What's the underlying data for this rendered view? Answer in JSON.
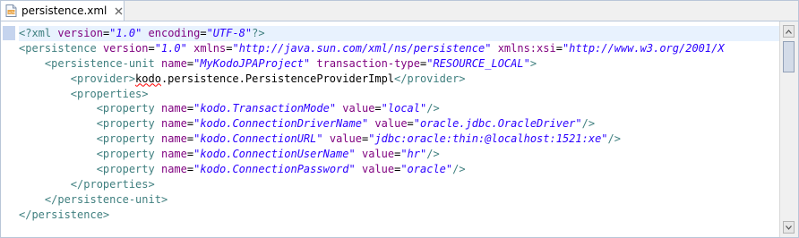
{
  "tab": {
    "label": "persistence.xml",
    "icon": "xml-file-icon",
    "close_icon": "close-icon"
  },
  "colors": {
    "tag": "#3f7f7f",
    "attribute": "#7f007f",
    "value": "#2a00ff",
    "text": "#000000",
    "current_line": "#e8f2fe"
  },
  "code": {
    "l1": {
      "open": "<?xml",
      "a1": "version",
      "eq1": "=",
      "v1": "\"1.0\"",
      "a2": "encoding",
      "eq2": "=",
      "v2": "\"UTF-8\"",
      "close": "?>"
    },
    "l2": {
      "open": "<persistence",
      "a1": "version",
      "eq1": "=",
      "v1": "\"1.0\"",
      "a2": "xmlns",
      "eq2": "=",
      "v2": "\"http://java.sun.com/xml/ns/persistence\"",
      "a3": "xmlns:xsi",
      "eq3": "=",
      "v3": "\"http://www.w3.org/2001/X"
    },
    "l3": {
      "open": "<persistence-unit",
      "a1": "name",
      "eq1": "=",
      "v1": "\"MyKodoJPAProject\"",
      "a2": "transaction-type",
      "eq2": "=",
      "v2": "\"RESOURCE_LOCAL\"",
      "close": ">"
    },
    "l4": {
      "open": "<provider>",
      "text_underlined": "kodo",
      "text_rest": ".persistence.PersistenceProviderImpl",
      "close": "</provider>"
    },
    "l5": {
      "open": "<properties>"
    },
    "props": [
      {
        "open": "<property",
        "a1": "name",
        "eq1": "=",
        "v1": "\"kodo.TransactionMode\"",
        "a2": "value",
        "eq2": "=",
        "v2": "\"local\"",
        "close": "/>"
      },
      {
        "open": "<property",
        "a1": "name",
        "eq1": "=",
        "v1": "\"kodo.ConnectionDriverName\"",
        "a2": "value",
        "eq2": "=",
        "v2": "\"oracle.jdbc.OracleDriver\"",
        "close": "/>"
      },
      {
        "open": "<property",
        "a1": "name",
        "eq1": "=",
        "v1": "\"kodo.ConnectionURL\"",
        "a2": "value",
        "eq2": "=",
        "v2": "\"jdbc:oracle:thin:@localhost:1521:xe\"",
        "close": "/>"
      },
      {
        "open": "<property",
        "a1": "name",
        "eq1": "=",
        "v1": "\"kodo.ConnectionUserName\"",
        "a2": "value",
        "eq2": "=",
        "v2": "\"hr\"",
        "close": "/>"
      },
      {
        "open": "<property",
        "a1": "name",
        "eq1": "=",
        "v1": "\"kodo.ConnectionPassword\"",
        "a2": "value",
        "eq2": "=",
        "v2": "\"oracle\"",
        "close": "/>"
      }
    ],
    "l11": {
      "close": "</properties>"
    },
    "l12": {
      "close": "</persistence-unit>"
    },
    "l13": {
      "close": "</persistence>"
    }
  }
}
